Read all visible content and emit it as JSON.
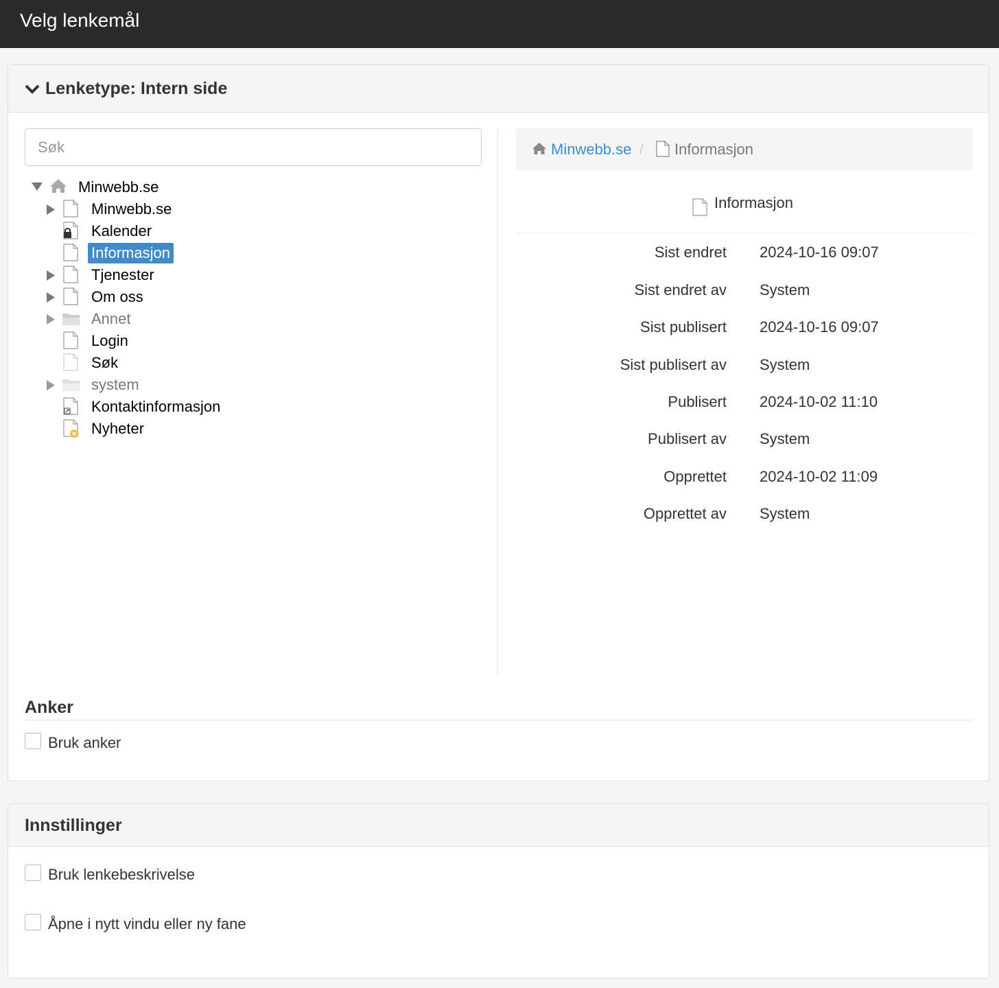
{
  "header": {
    "title": "Velg lenkemål"
  },
  "link_type": {
    "label": "Lenketype: Intern side"
  },
  "search": {
    "placeholder": "Søk"
  },
  "tree": {
    "root": "Minwebb.se",
    "items": [
      "Minwebb.se",
      "Kalender",
      "Informasjon",
      "Tjenester",
      "Om oss",
      "Annet",
      "Login",
      "Søk",
      "system",
      "Kontaktinformasjon",
      "Nyheter"
    ]
  },
  "breadcrumb": {
    "home": "Minwebb.se",
    "separator": "/",
    "current": "Informasjon"
  },
  "details": {
    "title": "Informasjon",
    "rows": [
      {
        "label": "Sist endret",
        "value": "2024-10-16 09:07"
      },
      {
        "label": "Sist endret av",
        "value": "System"
      },
      {
        "label": "Sist publisert",
        "value": "2024-10-16 09:07"
      },
      {
        "label": "Sist publisert av",
        "value": "System"
      },
      {
        "label": "Publisert",
        "value": "2024-10-02 11:10"
      },
      {
        "label": "Publisert av",
        "value": "System"
      },
      {
        "label": "Opprettet",
        "value": "2024-10-02 11:09"
      },
      {
        "label": "Opprettet av",
        "value": "System"
      }
    ]
  },
  "anchor": {
    "heading": "Anker",
    "checkbox_label": "Bruk anker"
  },
  "settings": {
    "heading": "Innstillinger",
    "use_description_label": "Bruk lenkebeskrivelse",
    "new_window_label": "Åpne i nytt vindu eller ny fane"
  },
  "colors": {
    "accent": "#428bca",
    "topbar": "#2b2b2b"
  }
}
